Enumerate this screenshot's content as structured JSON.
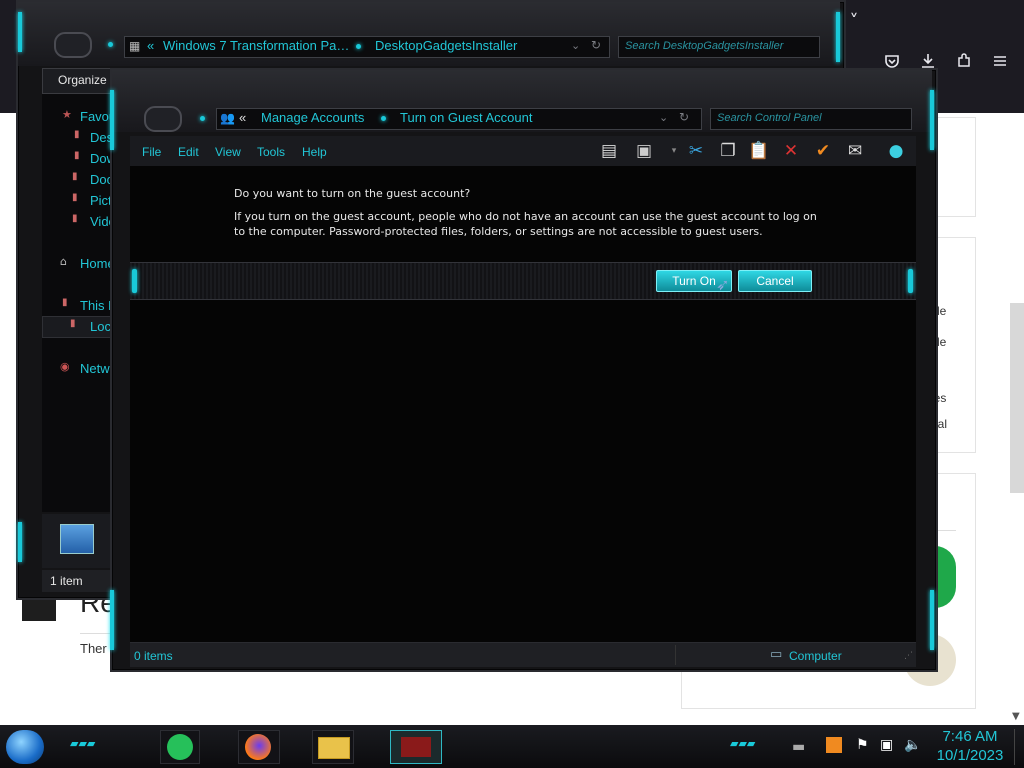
{
  "browser": {
    "tab_chevron": "˅",
    "toolbar_icons": [
      "pocket-icon",
      "download-icon",
      "extensions-icon",
      "menu-icon"
    ]
  },
  "page": {
    "sidebar_links": [
      "file",
      "file",
      "les",
      "nal"
    ],
    "heading_partial": "Re",
    "paragraph_partial": "Ther"
  },
  "explorer_back": {
    "breadcrumb": [
      "Windows 7 Transformation Pa…",
      "DesktopGadgetsInstaller"
    ],
    "search_placeholder": "Search DesktopGadgetsInstaller",
    "organize_label": "Organize",
    "nav": {
      "favorites": "Favou",
      "desktop": "Des",
      "downloads": "Dow",
      "documents": "Doc",
      "pictures": "Pict",
      "videos": "Vide",
      "home": "Home",
      "this_pc": "This P",
      "local": "Loca",
      "network": "Netwo"
    },
    "status_count": "1 item",
    "status_extra": "1"
  },
  "control_panel": {
    "breadcrumb": [
      "Manage Accounts",
      "Turn on Guest Account"
    ],
    "search_placeholder": "Search Control Panel",
    "menu": [
      "File",
      "Edit",
      "View",
      "Tools",
      "Help"
    ],
    "question": "Do you want to turn on the guest account?",
    "description": "If you turn on the guest account, people who do not have an account can use the guest account to log on to the computer. Password-protected files, folders, or settings are not accessible to guest users.",
    "turn_on_label": "Turn On",
    "cancel_label": "Cancel",
    "status_items": "0 items",
    "status_computer": "Computer"
  },
  "taskbar": {
    "time": "7:46 AM",
    "date": "10/1/2023",
    "tray_icons": [
      "keyboard-icon",
      "flag-icon",
      "network-icon",
      "volume-icon"
    ]
  },
  "colors": {
    "accent": "#21c8d8",
    "frame": "#141416",
    "content_bg": "#050505"
  }
}
